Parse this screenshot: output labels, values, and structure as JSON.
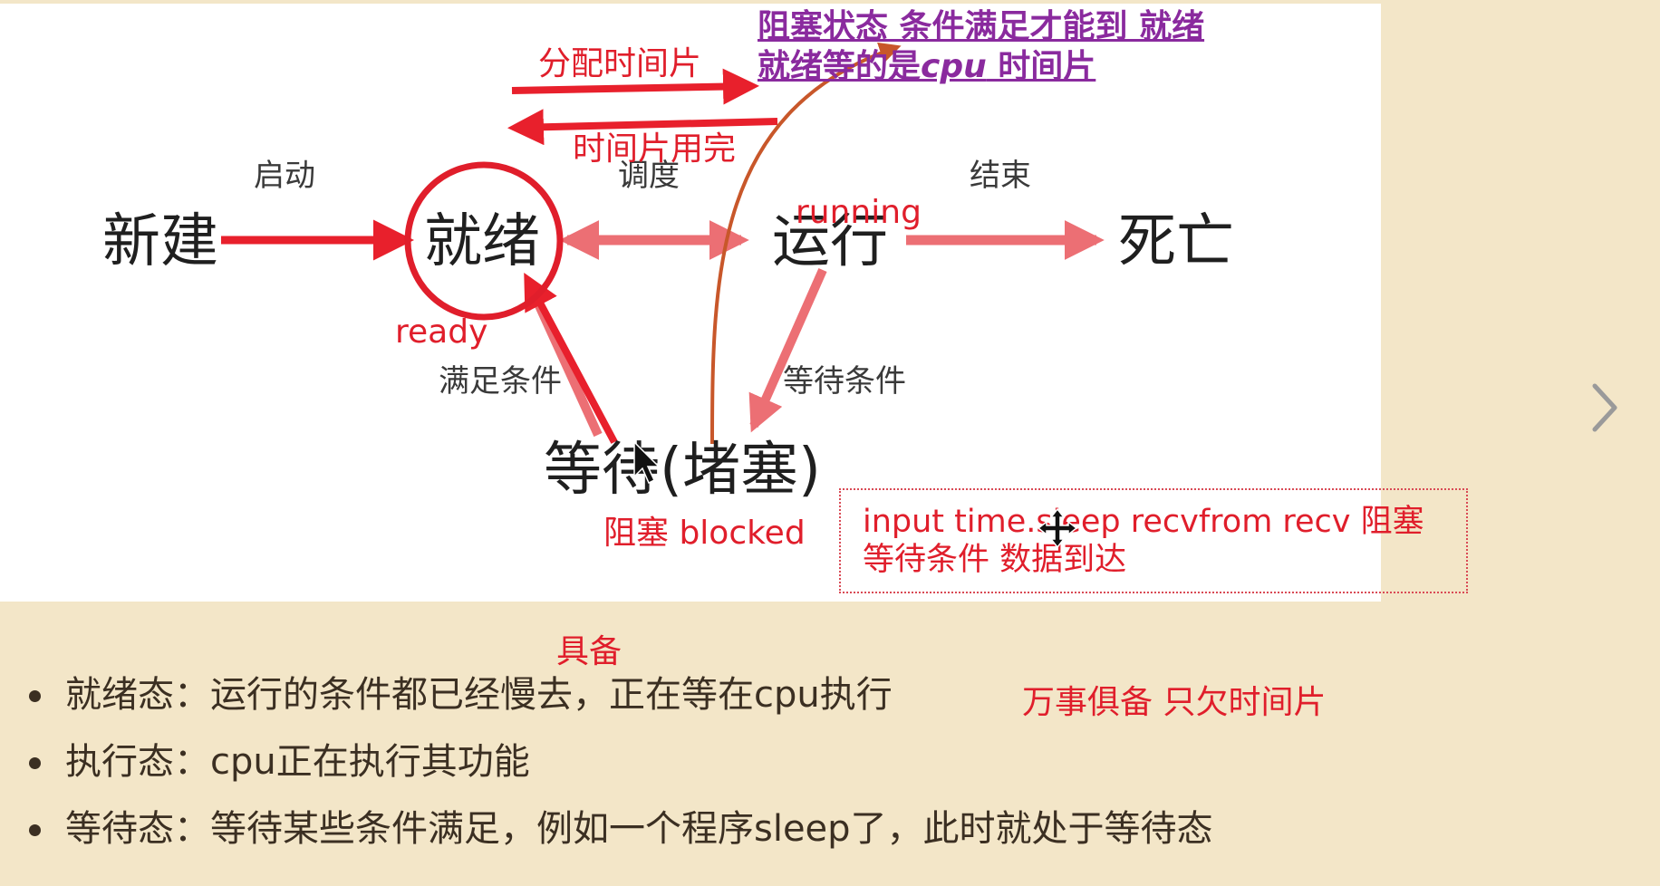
{
  "colors": {
    "background": "#f3e6c8",
    "panel": "#ffffff",
    "annotation_red": "#e01e2b",
    "annotation_purple": "#8a2a9e",
    "annotation_orange": "#c8572a",
    "body_text": "#3b2f22"
  },
  "diagram": {
    "nodes": {
      "new": "新建",
      "ready": "就绪",
      "running": "运行",
      "dead": "死亡",
      "waiting": "等待(堵塞)"
    },
    "edge_labels": {
      "start": "启动",
      "schedule": "调度",
      "end": "结束",
      "condition_met": "满足条件",
      "wait_condition": "等待条件"
    }
  },
  "annotations": {
    "allocate_slice": "分配时间片",
    "slice_used_up": "时间片用完",
    "running_label": "running",
    "ready_label": "ready",
    "blocked_label": "阻塞 blocked",
    "blocked_note_line1": "阻塞状态 条件满足才能到 就绪",
    "blocked_note_line2_prefix": "就绪等的是",
    "blocked_note_line2_cpu": "cpu",
    "blocked_note_line2_suffix": " 时间片",
    "box_line1": "input  time.sleep recvfrom recv 阻塞",
    "box_line2": "等待条件 数据到达",
    "juebei": "具备",
    "wanshi": "万事俱备 只欠时间片"
  },
  "bullets": [
    "就绪态：运行的条件都已经慢去，正在等在cpu执行",
    "执行态：cpu正在执行其功能",
    "等待态：等待某些条件满足，例如一个程序sleep了，此时就处于等待态"
  ],
  "icons": {
    "next": "chevron-right-icon",
    "cursor": "mouse-pointer-icon",
    "move": "move-cursor-icon"
  }
}
